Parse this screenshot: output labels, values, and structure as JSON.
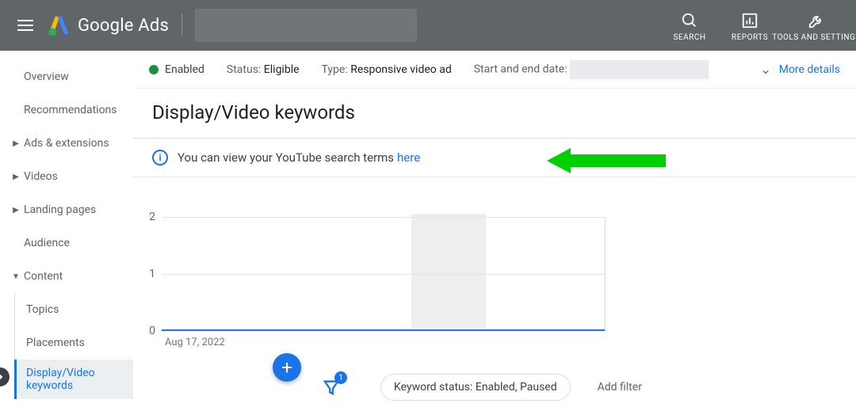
{
  "header": {
    "brand": "Google Ads",
    "buttons": {
      "search": "SEARCH",
      "reports": "REPORTS",
      "tools": "TOOLS AND SETTINGS"
    }
  },
  "sidebar": {
    "items": [
      {
        "label": "Overview"
      },
      {
        "label": "Recommendations"
      },
      {
        "label": "Ads & extensions",
        "caret": true
      },
      {
        "label": "Videos",
        "caret": true
      },
      {
        "label": "Landing pages",
        "caret": true
      },
      {
        "label": "Audience"
      },
      {
        "label": "Content",
        "caret": true,
        "expanded": true
      }
    ],
    "subitems": [
      {
        "label": "Topics"
      },
      {
        "label": "Placements"
      },
      {
        "label": "Display/Video keywords",
        "active": true
      }
    ]
  },
  "statusbar": {
    "enabled": "Enabled",
    "status_lbl": "Status:",
    "status_val": "Eligible",
    "type_lbl": "Type:",
    "type_val": "Responsive video ad",
    "date_lbl": "Start and end date:",
    "more_details": "More details"
  },
  "page_title": "Display/Video keywords",
  "info_text": "You can view your YouTube search terms",
  "info_link": "here",
  "filter": {
    "chip": "Keyword status: Enabled, Paused",
    "add": "Add filter",
    "badge": "1"
  },
  "chart_data": {
    "type": "line",
    "x": [
      "Aug 17, 2022"
    ],
    "series": [
      {
        "name": "",
        "values": [
          0
        ]
      }
    ],
    "ylim": [
      0,
      2
    ],
    "yticks": [
      0,
      1,
      2
    ],
    "xlabel": "",
    "ylabel": "",
    "title": ""
  }
}
